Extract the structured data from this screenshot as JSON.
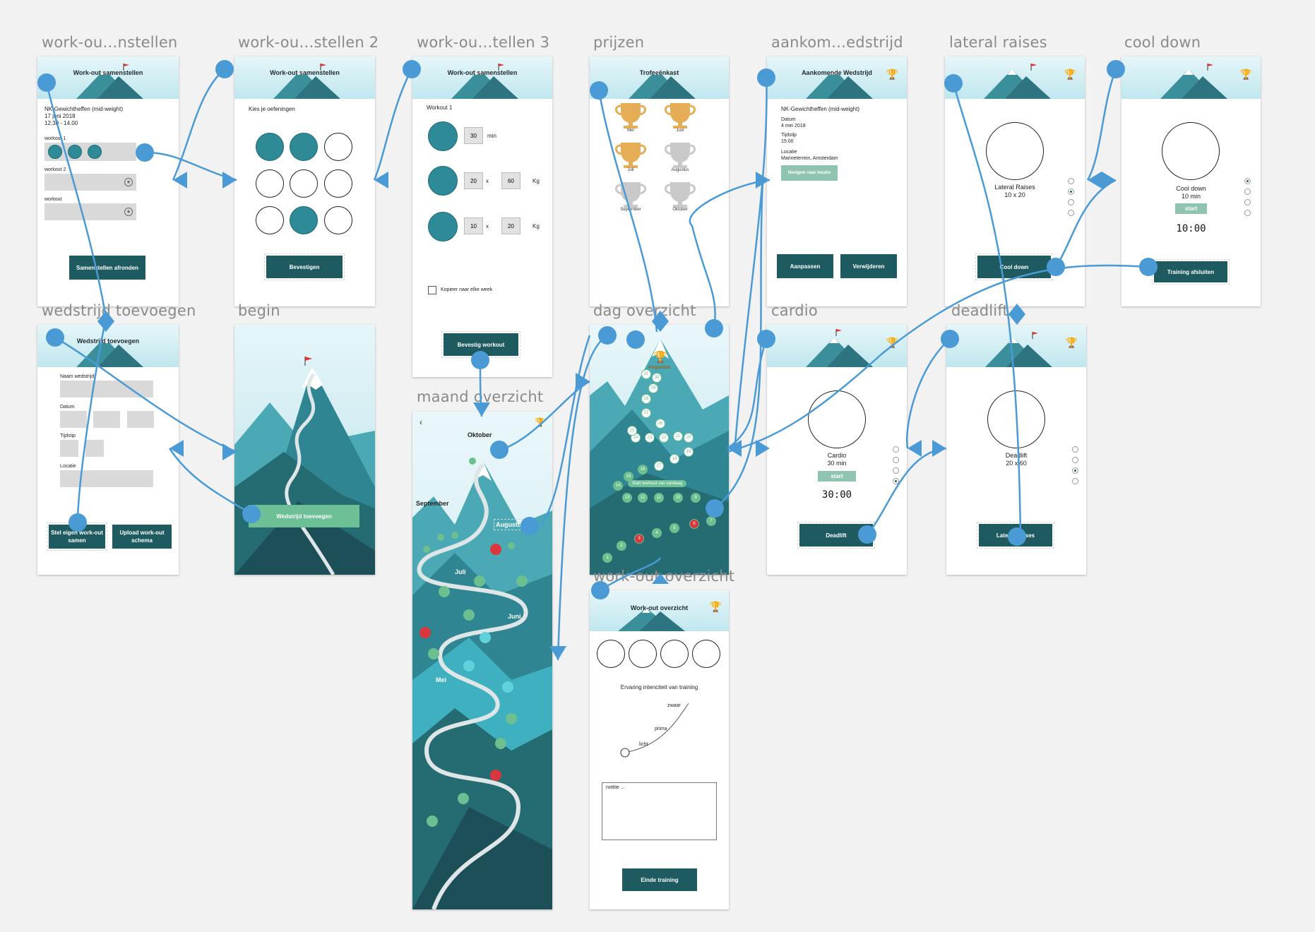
{
  "artboards": {
    "a1": {
      "title": "work-ou…nstellen",
      "header": "Work-out samenstellen",
      "event": "NK-Gewichtheffen (mid-weight)",
      "date": "17 juni 2018",
      "time": "12:30 - 14.00",
      "workout1": "workout 1",
      "workout2": "workout 2",
      "workout3": "workout",
      "button": "Samenstellen afronden"
    },
    "a2": {
      "title": "work-ou…stellen 2",
      "header": "Work-out samenstellen",
      "subtitle": "Kies je oefeningen",
      "button": "Bevestigen"
    },
    "a3": {
      "title": "work-ou…tellen 3",
      "header": "Work-out samenstellen",
      "label": "Workout 1",
      "row1_value": "30",
      "row1_unit": "min",
      "row2_a": "20",
      "row2_b": "60",
      "row3_a": "10",
      "row3_b": "20",
      "times": "x",
      "kg": "Kg",
      "checkbox": "Kopieer naar elke week",
      "button": "Bevestig workout"
    },
    "a4": {
      "title": "prijzen",
      "header": "Trofeeënkast",
      "months": [
        "Mei",
        "Juni",
        "Juli",
        "Augustus",
        "September",
        "Oktober"
      ]
    },
    "a5": {
      "title": "aankom…edstrijd",
      "header": "Aankomende Wedstrijd",
      "event": "NK-Gewichtheffen (mid-weight)",
      "datum_label": "Datum",
      "datum": "4 mei 2018",
      "tijd_label": "Tijdstip",
      "tijd": "15:00",
      "locatie_label": "Locatie",
      "locatie": "Marineterrein, Amsterdam",
      "nav_button": "Navigeer naar locatie",
      "btn1": "Aanpassen",
      "btn2": "Verwijderen"
    },
    "a6": {
      "title": "lateral raises",
      "name": "Lateral Raises",
      "sets": "10 x 20",
      "button": "Cool down"
    },
    "a7": {
      "title": "cool down",
      "name": "Cool down",
      "duration": "10 min",
      "start": "start",
      "clock": "10:00",
      "button": "Training afsluiten"
    },
    "a8": {
      "title": "wedstrijd toevoegen",
      "header": "Wedstrijd toevoegen",
      "naam": "Naam wedstrijd",
      "datum": "Datum",
      "tijd": "Tijdstip",
      "locatie": "Locatie",
      "btn1": "Stel eigen work-out samen",
      "btn2": "Upload work-out schema"
    },
    "a9": {
      "title": "begin",
      "button": "Wedstrijd toevoegen"
    },
    "a10": {
      "title": "maand overzicht",
      "months": [
        "Oktober",
        "September",
        "Augustus",
        "Juli",
        "Juni",
        "Mei"
      ]
    },
    "a11": {
      "title": "dag overzicht",
      "month": "Augustus",
      "start_label": "Start workout van vandaag",
      "days": [
        "1",
        "2",
        "3",
        "4",
        "5",
        "6",
        "7",
        "8",
        "9",
        "10",
        "11",
        "12",
        "13",
        "14",
        "15",
        "16",
        "17",
        "18",
        "19",
        "20",
        "21",
        "22",
        "23",
        "24",
        "25",
        "26",
        "27",
        "28",
        "29",
        "30",
        "31"
      ]
    },
    "a12": {
      "title": "cardio",
      "name": "Cardio",
      "duration": "30 min",
      "start": "start",
      "clock": "30:00",
      "button": "Deadlift"
    },
    "a13": {
      "title": "deadlift",
      "name": "Deadlift",
      "sets": "20 x 60",
      "button": "Lateral Raises"
    },
    "a14": {
      "title": "work-out overzicht",
      "header": "Work-out overzicht",
      "question": "Ervaring intenciteit van training",
      "levels": [
        "zwaar",
        "prima",
        "licht"
      ],
      "note": "notitie ...",
      "button": "Einde training"
    }
  },
  "colors": {
    "wire": "#4a9ad6",
    "teal": "#2e8a97",
    "dark_teal": "#1e5b60",
    "green": "#6cc08f",
    "red": "#d9363e",
    "gold": "#e5ad55",
    "silver": "#c9c9c9"
  }
}
